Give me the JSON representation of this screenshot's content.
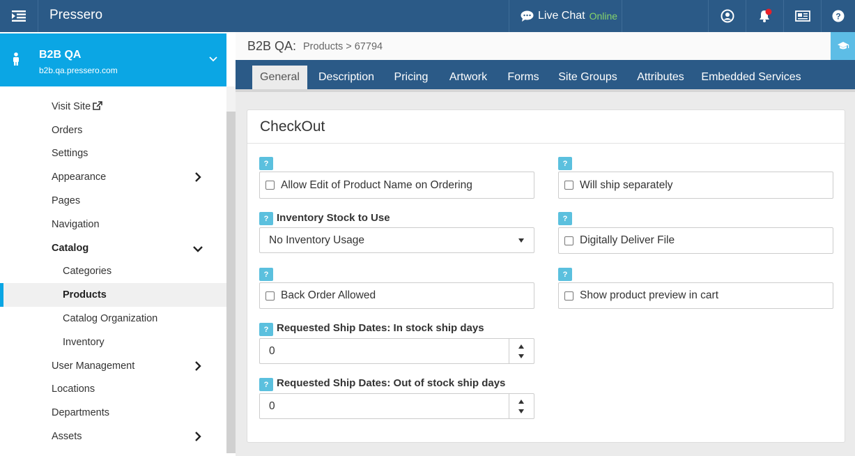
{
  "colors": {
    "topbar": "#2b5a87",
    "accent": "#0ba6e4",
    "help": "#5bc0de",
    "online": "#86d36b"
  },
  "topbar": {
    "menu_icon": "list-indent-icon",
    "brand": "Pressero",
    "chat_label": "Live Chat",
    "chat_status": "Online",
    "icons": [
      "user-circle-icon",
      "bell-icon",
      "newspaper-icon",
      "question-circle-icon"
    ]
  },
  "site": {
    "name": "B2B QA",
    "url": "b2b.qa.pressero.com"
  },
  "sidebar": {
    "items": [
      {
        "label": "Visit Site"
      },
      {
        "label": "Orders"
      },
      {
        "label": "Settings"
      },
      {
        "label": "Appearance"
      },
      {
        "label": "Pages"
      },
      {
        "label": "Navigation"
      },
      {
        "label": "Catalog"
      },
      {
        "label": "Categories"
      },
      {
        "label": "Products"
      },
      {
        "label": "Catalog Organization"
      },
      {
        "label": "Inventory"
      },
      {
        "label": "User Management"
      },
      {
        "label": "Locations"
      },
      {
        "label": "Departments"
      },
      {
        "label": "Assets"
      }
    ]
  },
  "breadcrumb": {
    "site": "B2B QA:",
    "path": "Products > 67794"
  },
  "tabs": [
    {
      "label": "General"
    },
    {
      "label": "Description"
    },
    {
      "label": "Pricing"
    },
    {
      "label": "Artwork"
    },
    {
      "label": "Forms"
    },
    {
      "label": "Site Groups"
    },
    {
      "label": "Attributes"
    },
    {
      "label": "Embedded Services"
    }
  ],
  "panel": {
    "title": "CheckOut",
    "help_glyph": "?",
    "allow_edit_label": "Allow Edit of Product Name on Ordering",
    "will_ship_label": "Will ship separately",
    "inventory_label": "Inventory Stock to Use",
    "inventory_value": "No Inventory Usage",
    "digital_label": "Digitally Deliver File",
    "back_order_label": "Back Order Allowed",
    "preview_label": "Show product preview in cart",
    "in_stock_label": "Requested Ship Dates: In stock ship days",
    "in_stock_value": "0",
    "out_stock_label": "Requested Ship Dates: Out of stock ship days",
    "out_stock_value": "0"
  }
}
